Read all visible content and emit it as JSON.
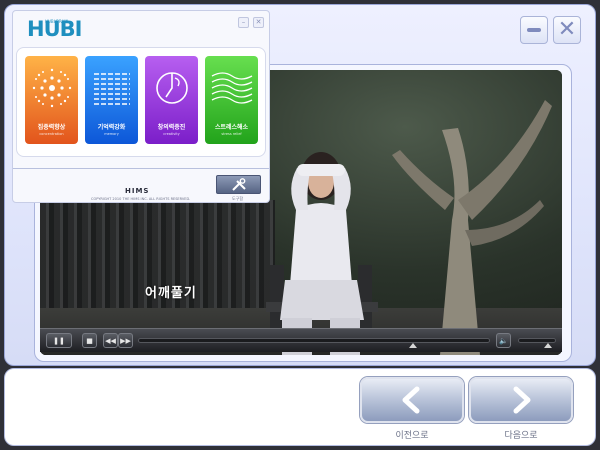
{
  "window": {
    "minimize_icon": "minimize-icon",
    "close_icon": "close-icon"
  },
  "menu_panel": {
    "logo_text": "HUBI",
    "logo_sub": "HUBI BRAIN",
    "tiles": [
      {
        "label": "집중력향상",
        "sub": "concentration",
        "icon": "sunburst-icon",
        "color": "#f07a2b"
      },
      {
        "label": "기억력강화",
        "sub": "memory",
        "icon": "grid-lines-icon",
        "color": "#1a6fe8"
      },
      {
        "label": "창의력증진",
        "sub": "creativity",
        "icon": "clock-face-icon",
        "color": "#9b37dd"
      },
      {
        "label": "스트레스해소",
        "sub": "stress relief",
        "icon": "waves-icon",
        "color": "#3cc32b"
      }
    ],
    "brand": "HIMS",
    "copyright": "COPYRIGHT 2010 THE HIMS INC. ALL RIGHTS RESERVED.",
    "tool_label": "도구함"
  },
  "video": {
    "subtitle": "어깨풀기",
    "progress_fraction": 0.78,
    "volume_fraction": 0.8
  },
  "navigation": {
    "prev_label": "이전으로",
    "next_label": "다음으로"
  }
}
